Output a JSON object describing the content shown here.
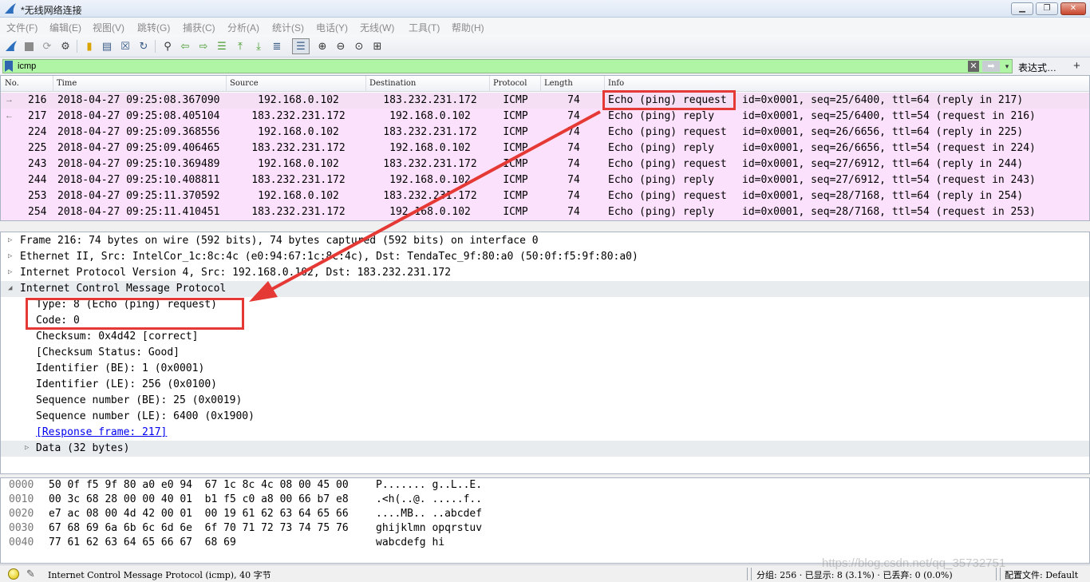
{
  "window": {
    "title": "*无线网络连接",
    "buttons": [
      "▁",
      "❐",
      "✕"
    ]
  },
  "menu": [
    "文件(F)",
    "编辑(E)",
    "视图(V)",
    "跳转(G)",
    "捕获(C)",
    "分析(A)",
    "统计(S)",
    "电话(Y)",
    "无线(W)",
    "工具(T)",
    "帮助(H)"
  ],
  "toolbar": {
    "icons": [
      "shark-fin-start-icon",
      "stop-icon",
      "restart-icon",
      "capture-options-icon",
      "open-file-icon",
      "save-file-icon",
      "close-file-icon",
      "reload-icon",
      "find-icon",
      "back-icon",
      "forward-icon",
      "goto-packet-icon",
      "first-packet-icon",
      "last-packet-icon",
      "autoscroll-icon",
      "colorize-icon",
      "zoom-in-icon",
      "zoom-out-icon",
      "zoom-reset-icon",
      "resize-columns-icon"
    ]
  },
  "filter": {
    "value": "icmp",
    "expression_label": "表达式…",
    "add_label": "+",
    "clear_label": "✕",
    "apply_label": "➡",
    "dropdown_label": "▾"
  },
  "packet_list": {
    "columns": [
      "No.",
      "Time",
      "Source",
      "Destination",
      "Protocol",
      "Length",
      "Info"
    ],
    "rows": [
      {
        "arrow": "→",
        "no": "216",
        "time": "2018-04-27 09:25:08.367090",
        "src": "192.168.0.102",
        "dst": "183.232.231.172",
        "proto": "ICMP",
        "len": "74",
        "info_a": "Echo (ping) request",
        "info_b": "id=0x0001, seq=25/6400, ttl=64 (reply in 217)"
      },
      {
        "arrow": "←",
        "no": "217",
        "time": "2018-04-27 09:25:08.405104",
        "src": "183.232.231.172",
        "dst": "192.168.0.102",
        "proto": "ICMP",
        "len": "74",
        "info_a": "Echo (ping) reply",
        "info_b": "id=0x0001, seq=25/6400, ttl=54 (request in 216)"
      },
      {
        "arrow": "",
        "no": "224",
        "time": "2018-04-27 09:25:09.368556",
        "src": "192.168.0.102",
        "dst": "183.232.231.172",
        "proto": "ICMP",
        "len": "74",
        "info_a": "Echo (ping) request",
        "info_b": "id=0x0001, seq=26/6656, ttl=64 (reply in 225)"
      },
      {
        "arrow": "",
        "no": "225",
        "time": "2018-04-27 09:25:09.406465",
        "src": "183.232.231.172",
        "dst": "192.168.0.102",
        "proto": "ICMP",
        "len": "74",
        "info_a": "Echo (ping) reply",
        "info_b": "id=0x0001, seq=26/6656, ttl=54 (request in 224)"
      },
      {
        "arrow": "",
        "no": "243",
        "time": "2018-04-27 09:25:10.369489",
        "src": "192.168.0.102",
        "dst": "183.232.231.172",
        "proto": "ICMP",
        "len": "74",
        "info_a": "Echo (ping) request",
        "info_b": "id=0x0001, seq=27/6912, ttl=64 (reply in 244)"
      },
      {
        "arrow": "",
        "no": "244",
        "time": "2018-04-27 09:25:10.408811",
        "src": "183.232.231.172",
        "dst": "192.168.0.102",
        "proto": "ICMP",
        "len": "74",
        "info_a": "Echo (ping) reply",
        "info_b": "id=0x0001, seq=27/6912, ttl=54 (request in 243)"
      },
      {
        "arrow": "",
        "no": "253",
        "time": "2018-04-27 09:25:11.370592",
        "src": "192.168.0.102",
        "dst": "183.232.231.172",
        "proto": "ICMP",
        "len": "74",
        "info_a": "Echo (ping) request",
        "info_b": "id=0x0001, seq=28/7168, ttl=64 (reply in 254)"
      },
      {
        "arrow": "",
        "no": "254",
        "time": "2018-04-27 09:25:11.410451",
        "src": "183.232.231.172",
        "dst": "192.168.0.102",
        "proto": "ICMP",
        "len": "74",
        "info_a": "Echo (ping) reply",
        "info_b": "id=0x0001, seq=28/7168, ttl=54 (request in 253)"
      }
    ]
  },
  "details": [
    {
      "tri": "▷",
      "text": "Frame 216: 74 bytes on wire (592 bits), 74 bytes captured (592 bits) on interface 0"
    },
    {
      "tri": "▷",
      "text": "Ethernet II, Src: IntelCor_1c:8c:4c (e0:94:67:1c:8c:4c), Dst: TendaTec_9f:80:a0 (50:0f:f5:9f:80:a0)"
    },
    {
      "tri": "▷",
      "text": "Internet Protocol Version 4, Src: 192.168.0.102, Dst: 183.232.231.172"
    },
    {
      "tri": "◢",
      "text": "Internet Control Message Protocol"
    },
    {
      "tri": "",
      "text": "Type: 8 (Echo (ping) request)"
    },
    {
      "tri": "",
      "text": "Code: 0"
    },
    {
      "tri": "",
      "text": "Checksum: 0x4d42 [correct]"
    },
    {
      "tri": "",
      "text": "[Checksum Status: Good]"
    },
    {
      "tri": "",
      "text": "Identifier (BE): 1 (0x0001)"
    },
    {
      "tri": "",
      "text": "Identifier (LE): 256 (0x0100)"
    },
    {
      "tri": "",
      "text": "Sequence number (BE): 25 (0x0019)"
    },
    {
      "tri": "",
      "text": "Sequence number (LE): 6400 (0x1900)"
    },
    {
      "tri": "",
      "text": "[Response frame: 217]"
    },
    {
      "tri": "▷",
      "text": "Data (32 bytes)"
    }
  ],
  "bytes": [
    {
      "off": "0000",
      "hex": "50 0f f5 9f 80 a0 e0 94  67 1c 8c 4c 08 00 45 00",
      "asc": "P....... g..L..E."
    },
    {
      "off": "0010",
      "hex": "00 3c 68 28 00 00 40 01  b1 f5 c0 a8 00 66 b7 e8",
      "asc": ".<h(..@. .....f.."
    },
    {
      "off": "0020",
      "hex": "e7 ac 08 00 4d 42 00 01  00 19 61 62 63 64 65 66",
      "asc": "....MB.. ..abcdef"
    },
    {
      "off": "0030",
      "hex": "67 68 69 6a 6b 6c 6d 6e  6f 70 71 72 73 74 75 76",
      "asc": "ghijklmn opqrstuv"
    },
    {
      "off": "0040",
      "hex": "77 61 62 63 64 65 66 67  68 69",
      "asc": "wabcdefg hi"
    }
  ],
  "status": {
    "message": "Internet Control Message Protocol (icmp), 40 字节",
    "groups": "分组: 256 · 已显示: 8 (3.1%) · 已丢弃: 0 (0.0%)",
    "profile": "配置文件: Default",
    "watermark": "https://blog.csdn.net/qq_35732751"
  },
  "colors": {
    "row_bg": "#fbe1fb",
    "filter_ok": "#aff5a5",
    "annotation": "#e53935",
    "link": "#0000ee"
  }
}
